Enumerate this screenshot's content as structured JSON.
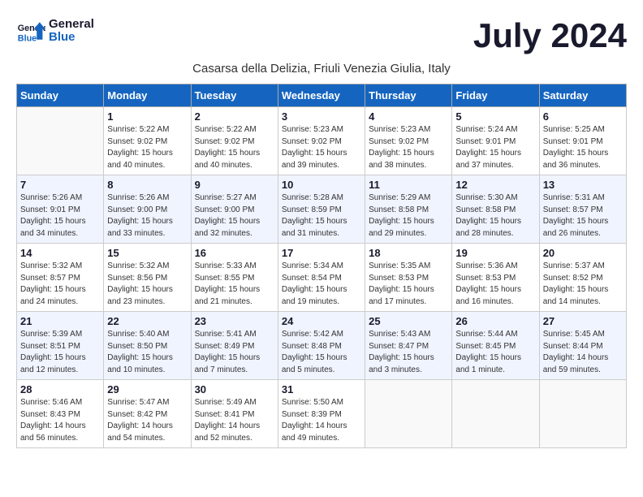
{
  "logo": {
    "text_general": "General",
    "text_blue": "Blue"
  },
  "title": "July 2024",
  "subtitle": "Casarsa della Delizia, Friuli Venezia Giulia, Italy",
  "headers": [
    "Sunday",
    "Monday",
    "Tuesday",
    "Wednesday",
    "Thursday",
    "Friday",
    "Saturday"
  ],
  "weeks": [
    [
      {
        "day": "",
        "info": ""
      },
      {
        "day": "1",
        "info": "Sunrise: 5:22 AM\nSunset: 9:02 PM\nDaylight: 15 hours\nand 40 minutes."
      },
      {
        "day": "2",
        "info": "Sunrise: 5:22 AM\nSunset: 9:02 PM\nDaylight: 15 hours\nand 40 minutes."
      },
      {
        "day": "3",
        "info": "Sunrise: 5:23 AM\nSunset: 9:02 PM\nDaylight: 15 hours\nand 39 minutes."
      },
      {
        "day": "4",
        "info": "Sunrise: 5:23 AM\nSunset: 9:02 PM\nDaylight: 15 hours\nand 38 minutes."
      },
      {
        "day": "5",
        "info": "Sunrise: 5:24 AM\nSunset: 9:01 PM\nDaylight: 15 hours\nand 37 minutes."
      },
      {
        "day": "6",
        "info": "Sunrise: 5:25 AM\nSunset: 9:01 PM\nDaylight: 15 hours\nand 36 minutes."
      }
    ],
    [
      {
        "day": "7",
        "info": "Sunrise: 5:26 AM\nSunset: 9:01 PM\nDaylight: 15 hours\nand 34 minutes."
      },
      {
        "day": "8",
        "info": "Sunrise: 5:26 AM\nSunset: 9:00 PM\nDaylight: 15 hours\nand 33 minutes."
      },
      {
        "day": "9",
        "info": "Sunrise: 5:27 AM\nSunset: 9:00 PM\nDaylight: 15 hours\nand 32 minutes."
      },
      {
        "day": "10",
        "info": "Sunrise: 5:28 AM\nSunset: 8:59 PM\nDaylight: 15 hours\nand 31 minutes."
      },
      {
        "day": "11",
        "info": "Sunrise: 5:29 AM\nSunset: 8:58 PM\nDaylight: 15 hours\nand 29 minutes."
      },
      {
        "day": "12",
        "info": "Sunrise: 5:30 AM\nSunset: 8:58 PM\nDaylight: 15 hours\nand 28 minutes."
      },
      {
        "day": "13",
        "info": "Sunrise: 5:31 AM\nSunset: 8:57 PM\nDaylight: 15 hours\nand 26 minutes."
      }
    ],
    [
      {
        "day": "14",
        "info": "Sunrise: 5:32 AM\nSunset: 8:57 PM\nDaylight: 15 hours\nand 24 minutes."
      },
      {
        "day": "15",
        "info": "Sunrise: 5:32 AM\nSunset: 8:56 PM\nDaylight: 15 hours\nand 23 minutes."
      },
      {
        "day": "16",
        "info": "Sunrise: 5:33 AM\nSunset: 8:55 PM\nDaylight: 15 hours\nand 21 minutes."
      },
      {
        "day": "17",
        "info": "Sunrise: 5:34 AM\nSunset: 8:54 PM\nDaylight: 15 hours\nand 19 minutes."
      },
      {
        "day": "18",
        "info": "Sunrise: 5:35 AM\nSunset: 8:53 PM\nDaylight: 15 hours\nand 17 minutes."
      },
      {
        "day": "19",
        "info": "Sunrise: 5:36 AM\nSunset: 8:53 PM\nDaylight: 15 hours\nand 16 minutes."
      },
      {
        "day": "20",
        "info": "Sunrise: 5:37 AM\nSunset: 8:52 PM\nDaylight: 15 hours\nand 14 minutes."
      }
    ],
    [
      {
        "day": "21",
        "info": "Sunrise: 5:39 AM\nSunset: 8:51 PM\nDaylight: 15 hours\nand 12 minutes."
      },
      {
        "day": "22",
        "info": "Sunrise: 5:40 AM\nSunset: 8:50 PM\nDaylight: 15 hours\nand 10 minutes."
      },
      {
        "day": "23",
        "info": "Sunrise: 5:41 AM\nSunset: 8:49 PM\nDaylight: 15 hours\nand 7 minutes."
      },
      {
        "day": "24",
        "info": "Sunrise: 5:42 AM\nSunset: 8:48 PM\nDaylight: 15 hours\nand 5 minutes."
      },
      {
        "day": "25",
        "info": "Sunrise: 5:43 AM\nSunset: 8:47 PM\nDaylight: 15 hours\nand 3 minutes."
      },
      {
        "day": "26",
        "info": "Sunrise: 5:44 AM\nSunset: 8:45 PM\nDaylight: 15 hours\nand 1 minute."
      },
      {
        "day": "27",
        "info": "Sunrise: 5:45 AM\nSunset: 8:44 PM\nDaylight: 14 hours\nand 59 minutes."
      }
    ],
    [
      {
        "day": "28",
        "info": "Sunrise: 5:46 AM\nSunset: 8:43 PM\nDaylight: 14 hours\nand 56 minutes."
      },
      {
        "day": "29",
        "info": "Sunrise: 5:47 AM\nSunset: 8:42 PM\nDaylight: 14 hours\nand 54 minutes."
      },
      {
        "day": "30",
        "info": "Sunrise: 5:49 AM\nSunset: 8:41 PM\nDaylight: 14 hours\nand 52 minutes."
      },
      {
        "day": "31",
        "info": "Sunrise: 5:50 AM\nSunset: 8:39 PM\nDaylight: 14 hours\nand 49 minutes."
      },
      {
        "day": "",
        "info": ""
      },
      {
        "day": "",
        "info": ""
      },
      {
        "day": "",
        "info": ""
      }
    ]
  ]
}
